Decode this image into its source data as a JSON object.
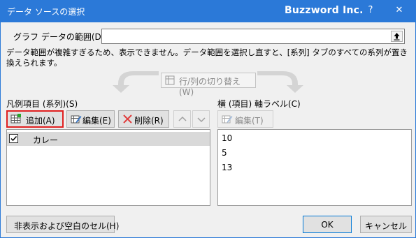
{
  "window": {
    "title": "データ ソースの選択",
    "brand": "Buzzword Inc.",
    "help": "?",
    "close": "✕"
  },
  "range": {
    "label": "グラフ データの範囲(D):",
    "value": ""
  },
  "warning_text": "データ範囲が複雑すぎるため、表示できません。データ範囲を選択し直すと、[系列] タブのすべての系列が置き換えられます。",
  "switch_button": "行/列の切り替え(W)",
  "legend": {
    "heading": "凡例項目 (系列)(S)",
    "add_label": "追加(A)",
    "edit_label": "編集(E)",
    "delete_label": "削除(R)",
    "series": [
      {
        "name": "カレー",
        "checked": true
      }
    ]
  },
  "axis": {
    "heading": "横 (項目) 軸ラベル(C)",
    "edit_label": "編集(T)",
    "items": [
      "10",
      "5",
      "13"
    ]
  },
  "footer": {
    "hidden_cells_label": "非表示および空白のセル(H)",
    "ok_label": "OK",
    "cancel_label": "キャンセル"
  },
  "icons": {
    "collapse": "collapse-dialog-icon",
    "switch": "switch-row-column-icon",
    "add": "add-table-icon",
    "edit": "edit-icon",
    "delete": "delete-x-icon",
    "up": "chevron-up-icon",
    "down": "chevron-down-icon",
    "checkbox": "checkmark-icon"
  },
  "colors": {
    "title_bar": "#2b79d8",
    "highlight_border": "#e02020",
    "delete_icon": "#e04040",
    "dialog_bg": "#f0f0f0"
  }
}
